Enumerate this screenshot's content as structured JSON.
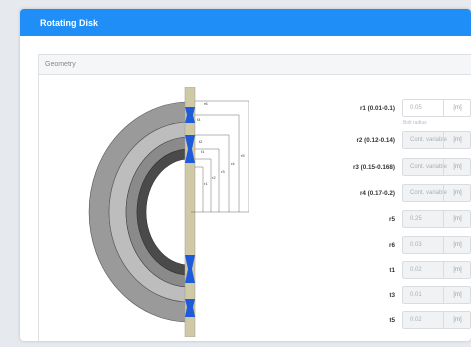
{
  "window": {
    "title": "Rotating Disk"
  },
  "panel": {
    "title": "Geometry"
  },
  "diagram": {
    "labels": [
      "r1",
      "r2",
      "r3",
      "r4",
      "r5",
      "r6"
    ],
    "thickness_labels": [
      "t3",
      "t2",
      "t1"
    ]
  },
  "params": [
    {
      "label": "r1 (0.01-0.1)",
      "value": "0.05",
      "unit": "[m]",
      "hint": "Bolt radius",
      "state": "editable"
    },
    {
      "label": "r2 (0.12-0.14)",
      "value": "Cont. variable",
      "unit": "[m]",
      "state": "disabled"
    },
    {
      "label": "r3 (0.15-0.168)",
      "value": "Cont. variable",
      "unit": "[m]",
      "state": "disabled"
    },
    {
      "label": "r4 (0.17-0.2)",
      "value": "Cont. variable",
      "unit": "[m]",
      "state": "disabled"
    },
    {
      "label": "r5",
      "value": "0.25",
      "unit": "[m]",
      "state": "disabled"
    },
    {
      "label": "r6",
      "value": "0.03",
      "unit": "[m]",
      "state": "disabled"
    },
    {
      "label": "t1",
      "value": "0.02",
      "unit": "[m]",
      "state": "disabled"
    },
    {
      "label": "t3",
      "value": "0.01",
      "unit": "[m]",
      "state": "disabled"
    },
    {
      "label": "t5",
      "value": "0.02",
      "unit": "[m]",
      "state": "disabled"
    }
  ],
  "colors": {
    "titlebar": "#1f8ef6",
    "shaft": "#cfc9a6",
    "hub": "#1e5bdc"
  }
}
